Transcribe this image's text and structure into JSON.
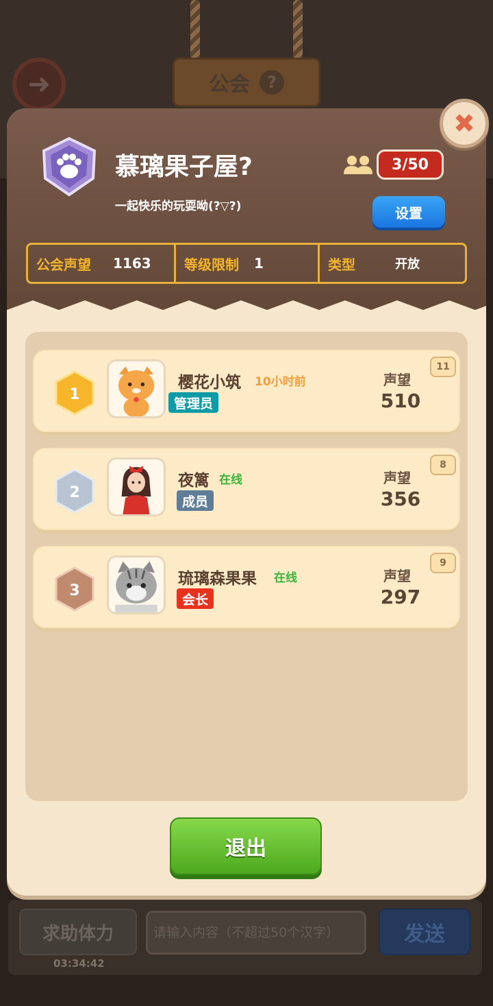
{
  "topbar": {
    "title": "公会",
    "help_icon": "?"
  },
  "guild": {
    "name": "慕璃果子屋?",
    "description": "一起快乐的玩耍呦(?▽?)",
    "member_count": "3/50",
    "settings_label": "设置",
    "stats": [
      {
        "label": "公会声望",
        "value": "1163"
      },
      {
        "label": "等级限制",
        "value": "1"
      },
      {
        "label": "类型",
        "value": "开放"
      }
    ]
  },
  "members": [
    {
      "rank": "1",
      "name": "樱花小筑",
      "status": "10小时前",
      "role": "管理员",
      "rep_label": "声望",
      "rep": "510",
      "level": "11"
    },
    {
      "rank": "2",
      "name": "夜篱",
      "status": "在线",
      "role": "成员",
      "rep_label": "声望",
      "rep": "356",
      "level": "8"
    },
    {
      "rank": "3",
      "name": "琉璃森果果",
      "status": "在线",
      "role": "会长",
      "rep_label": "声望",
      "rep": "297",
      "level": "9"
    }
  ],
  "exit_label": "退出",
  "chat": {
    "help_label": "求助体力",
    "timer": "03:34:42",
    "placeholder": "请输入内容（不超过50个汉字）",
    "send_label": "发送"
  },
  "colors": {
    "accent_gold": "#e8b23a",
    "online_green": "#3cb33a",
    "offline_orange": "#f0a040"
  }
}
